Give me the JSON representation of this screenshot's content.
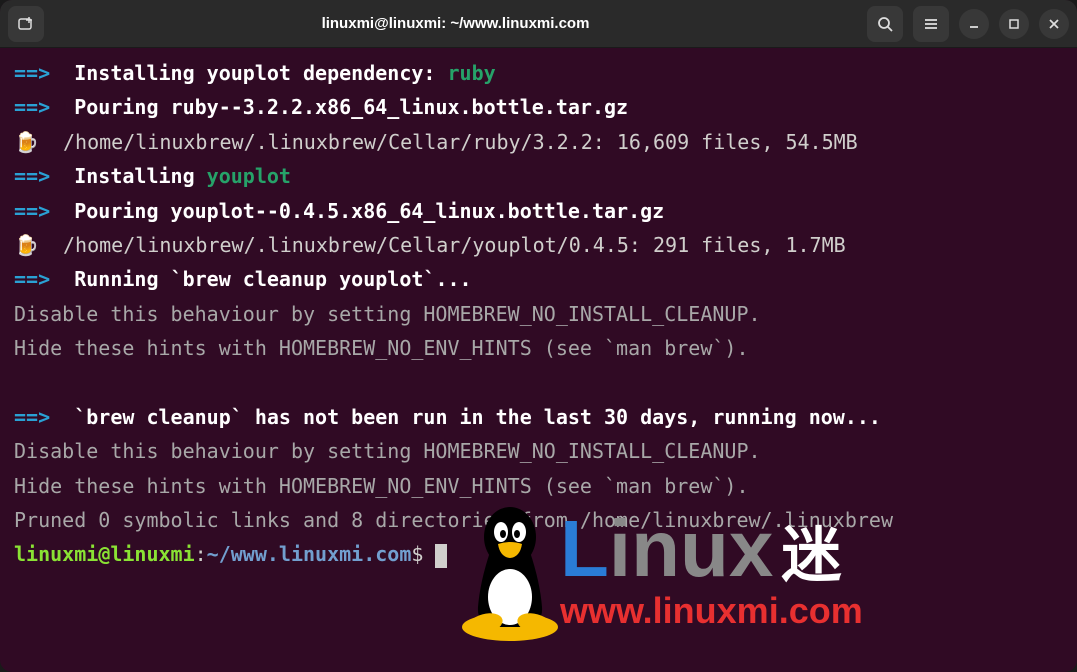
{
  "titlebar": {
    "title": "linuxmi@linuxmi: ~/www.linuxmi.com"
  },
  "terminal": {
    "lines": [
      {
        "parts": [
          {
            "cls": "arrow-blue",
            "t": "==>"
          },
          {
            "cls": "white-bold",
            "t": "  Installing youplot dependency: "
          },
          {
            "cls": "green-bold",
            "t": "ruby"
          }
        ]
      },
      {
        "parts": [
          {
            "cls": "arrow-blue",
            "t": "==>"
          },
          {
            "cls": "white-bold",
            "t": "  Pouring ruby--3.2.2.x86_64_linux.bottle.tar.gz"
          }
        ]
      },
      {
        "parts": [
          {
            "cls": "",
            "t": "🍺  /home/linuxbrew/.linuxbrew/Cellar/ruby/3.2.2: 16,609 files, 54.5MB"
          }
        ]
      },
      {
        "parts": [
          {
            "cls": "arrow-blue",
            "t": "==>"
          },
          {
            "cls": "white-bold",
            "t": "  Installing "
          },
          {
            "cls": "green-bold",
            "t": "youplot"
          }
        ]
      },
      {
        "parts": [
          {
            "cls": "arrow-blue",
            "t": "==>"
          },
          {
            "cls": "white-bold",
            "t": "  Pouring youplot--0.4.5.x86_64_linux.bottle.tar.gz"
          }
        ]
      },
      {
        "parts": [
          {
            "cls": "",
            "t": "🍺  /home/linuxbrew/.linuxbrew/Cellar/youplot/0.4.5: 291 files, 1.7MB"
          }
        ]
      },
      {
        "parts": [
          {
            "cls": "arrow-blue",
            "t": "==>"
          },
          {
            "cls": "white-bold",
            "t": "  Running `brew cleanup youplot`..."
          }
        ]
      },
      {
        "parts": [
          {
            "cls": "gray",
            "t": "Disable this behaviour by setting HOMEBREW_NO_INSTALL_CLEANUP."
          }
        ]
      },
      {
        "parts": [
          {
            "cls": "gray",
            "t": "Hide these hints with HOMEBREW_NO_ENV_HINTS (see `man brew`)."
          }
        ]
      },
      {
        "parts": [
          {
            "cls": "gray",
            "t": ""
          }
        ]
      },
      {
        "parts": [
          {
            "cls": "arrow-blue",
            "t": "==>"
          },
          {
            "cls": "white-bold",
            "t": "  `brew cleanup` has not been run in the last 30 days, running now..."
          }
        ]
      },
      {
        "parts": [
          {
            "cls": "gray",
            "t": "Disable this behaviour by setting HOMEBREW_NO_INSTALL_CLEANUP."
          }
        ]
      },
      {
        "parts": [
          {
            "cls": "gray",
            "t": "Hide these hints with HOMEBREW_NO_ENV_HINTS (see `man brew`)."
          }
        ]
      },
      {
        "parts": [
          {
            "cls": "gray",
            "t": "Pruned 0 symbolic links and 8 directories from /home/linuxbrew/.linuxbrew"
          }
        ]
      }
    ],
    "prompt": {
      "user": "linuxmi",
      "host": "linuxmi",
      "path": "~/www.linuxmi.com",
      "symbol": "$"
    }
  },
  "watermark": {
    "brand_l": "L",
    "brand_rest": "inux",
    "brand_mi": "迷",
    "url": "www.linuxmi.com"
  }
}
